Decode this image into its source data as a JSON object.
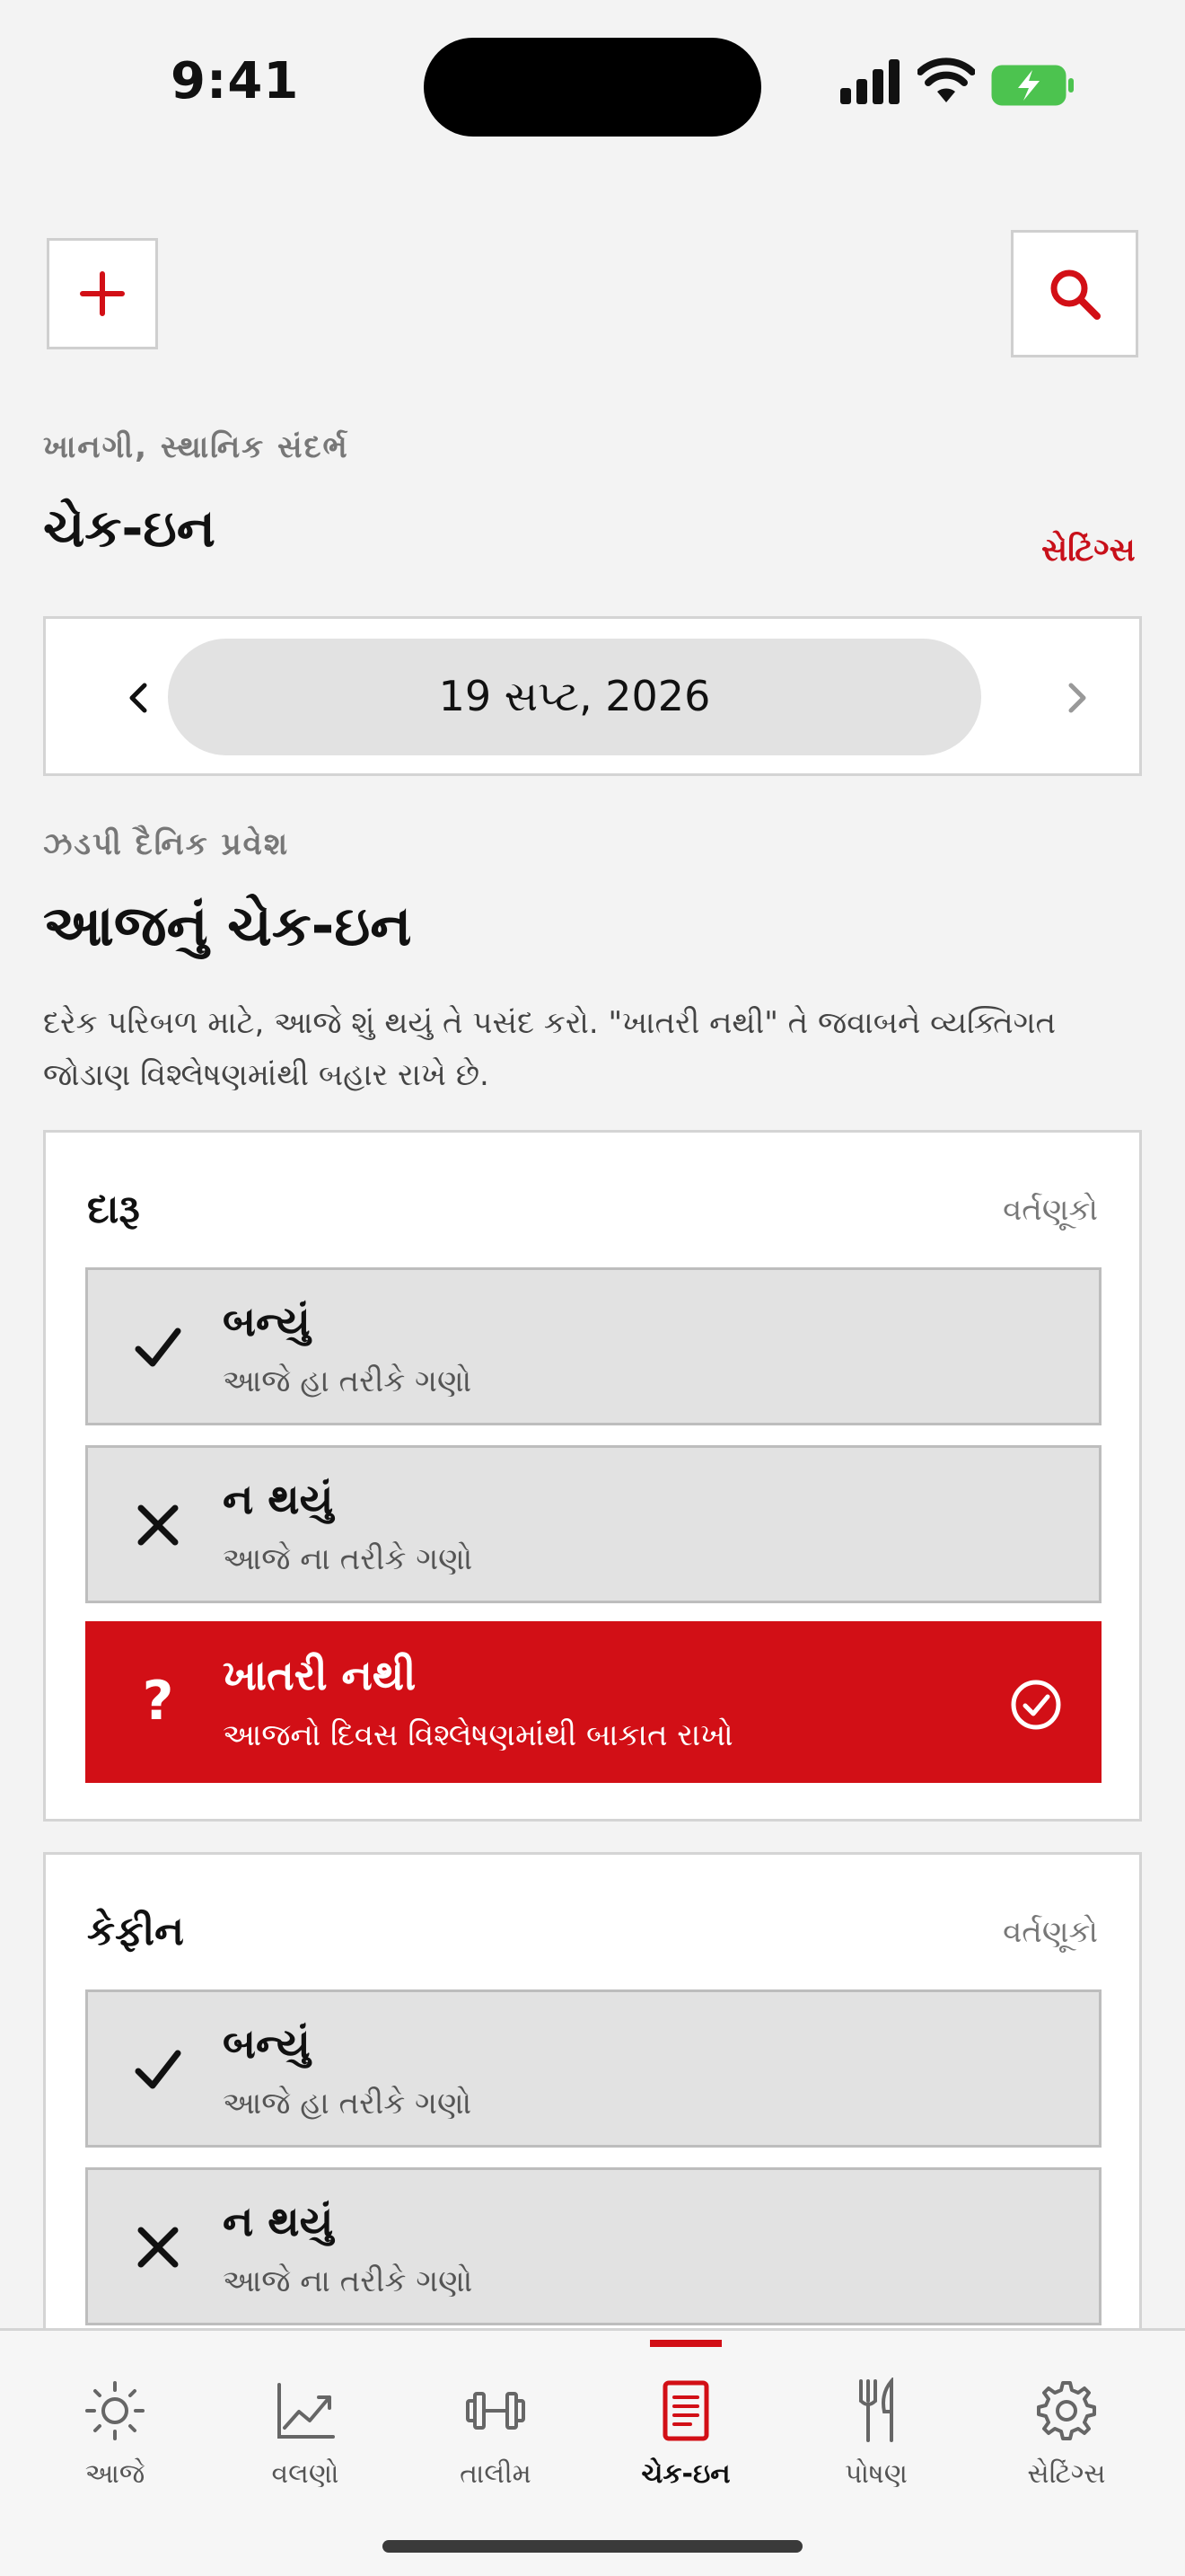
{
  "status": {
    "time": "9:41"
  },
  "header": {
    "eyebrow": "ખાનગી, સ્થાનિક સંદર્ભ",
    "title": "ચેક-ઇન",
    "settings_link": "સેટિંગ્સ"
  },
  "date_nav": {
    "date": "19 સપ્ટ, 2026"
  },
  "section": {
    "eyebrow": "ઝડપી દૈનિક પ્રવેશ",
    "title": "આજનું ચેક-ઇન",
    "description": "દરેક પરિબળ માટે, આજે શું થયું તે પસંદ કરો. \"ખાતરી નથી\" તે જવાબને વ્યક્તિગત જોડાણ વિશ્લેષણમાંથી બહાર રાખે છે."
  },
  "factors": [
    {
      "name": "દારૂ",
      "category": "વર્તણૂકો",
      "options": [
        {
          "label": "બન્યું",
          "sub": "આજે હા તરીકે ગણો",
          "icon": "check-icon"
        },
        {
          "label": "ન થયું",
          "sub": "આજે ના તરીકે ગણો",
          "icon": "x-icon"
        },
        {
          "label": "ખાતરી નથી",
          "sub": "આજનો દિવસ વિશ્લેષણમાંથી બાકાત રાખો",
          "icon": "question-icon"
        }
      ],
      "selected": 2
    },
    {
      "name": "કેફીન",
      "category": "વર્તણૂકો",
      "options": [
        {
          "label": "બન્યું",
          "sub": "આજે હા તરીકે ગણો",
          "icon": "check-icon"
        },
        {
          "label": "ન થયું",
          "sub": "આજે ના તરીકે ગણો",
          "icon": "x-icon"
        }
      ]
    }
  ],
  "tabs": [
    {
      "label": "આજે",
      "icon": "sun-icon"
    },
    {
      "label": "વલણો",
      "icon": "trend-icon"
    },
    {
      "label": "તાલીમ",
      "icon": "dumbbell-icon"
    },
    {
      "label": "ચેક-ઇન",
      "icon": "journal-icon",
      "active": true
    },
    {
      "label": "પોષણ",
      "icon": "fork-knife-icon"
    },
    {
      "label": "સેટિંગ્સ",
      "icon": "gear-icon"
    }
  ],
  "colors": {
    "accent": "#d20f16",
    "background": "#f3f3f3",
    "option_bg": "#e2e2e2"
  }
}
